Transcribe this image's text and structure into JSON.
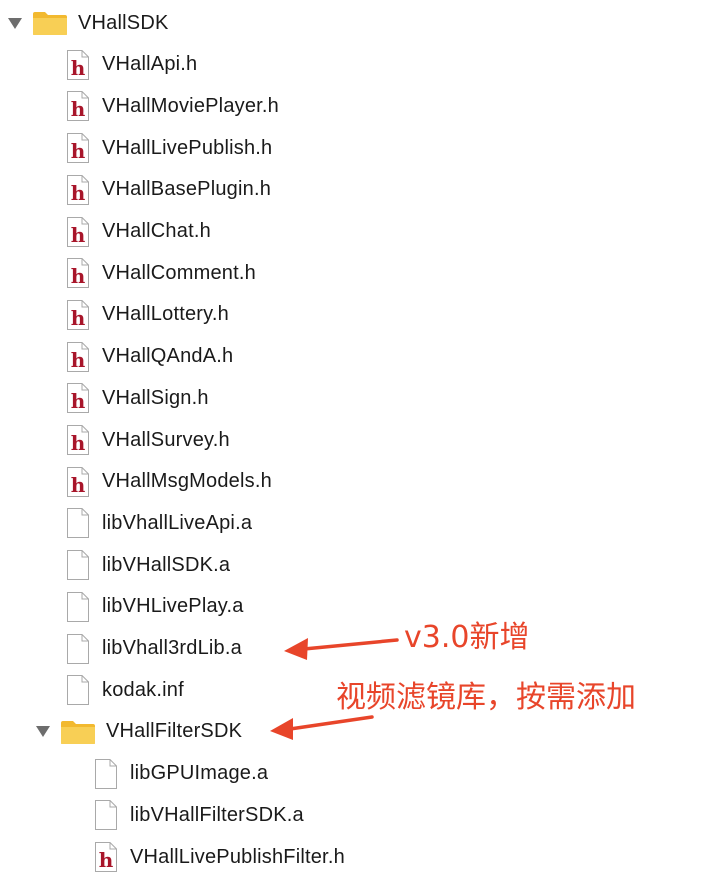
{
  "root": {
    "label": "VHallSDK",
    "icon": "folder-icon",
    "expanded": true
  },
  "root_files": [
    {
      "label": "VHallApi.h",
      "type": "header"
    },
    {
      "label": "VHallMoviePlayer.h",
      "type": "header"
    },
    {
      "label": "VHallLivePublish.h",
      "type": "header"
    },
    {
      "label": "VHallBasePlugin.h",
      "type": "header"
    },
    {
      "label": "VHallChat.h",
      "type": "header"
    },
    {
      "label": "VHallComment.h",
      "type": "header"
    },
    {
      "label": "VHallLottery.h",
      "type": "header"
    },
    {
      "label": "VHallQAndA.h",
      "type": "header"
    },
    {
      "label": "VHallSign.h",
      "type": "header"
    },
    {
      "label": "VHallSurvey.h",
      "type": "header"
    },
    {
      "label": "VHallMsgModels.h",
      "type": "header"
    },
    {
      "label": "libVhallLiveApi.a",
      "type": "file"
    },
    {
      "label": "libVHallSDK.a",
      "type": "file"
    },
    {
      "label": "libVHLivePlay.a",
      "type": "file"
    },
    {
      "label": "libVhall3rdLib.a",
      "type": "file"
    },
    {
      "label": "kodak.inf",
      "type": "file"
    }
  ],
  "subfolder": {
    "label": "VHallFilterSDK",
    "icon": "folder-icon",
    "expanded": true
  },
  "subfolder_files": [
    {
      "label": "libGPUImage.a",
      "type": "file"
    },
    {
      "label": "libVHallFilterSDK.a",
      "type": "file"
    },
    {
      "label": "VHallLivePublishFilter.h",
      "type": "header"
    }
  ],
  "annotations": {
    "new_in_version": "v3.0新增",
    "filter_note": "视频滤镜库，按需添加",
    "color": "#e8452a"
  },
  "colors": {
    "folder": "#f5c342",
    "header_h": "#a8152a",
    "disclosure": "#6d6d6d"
  }
}
